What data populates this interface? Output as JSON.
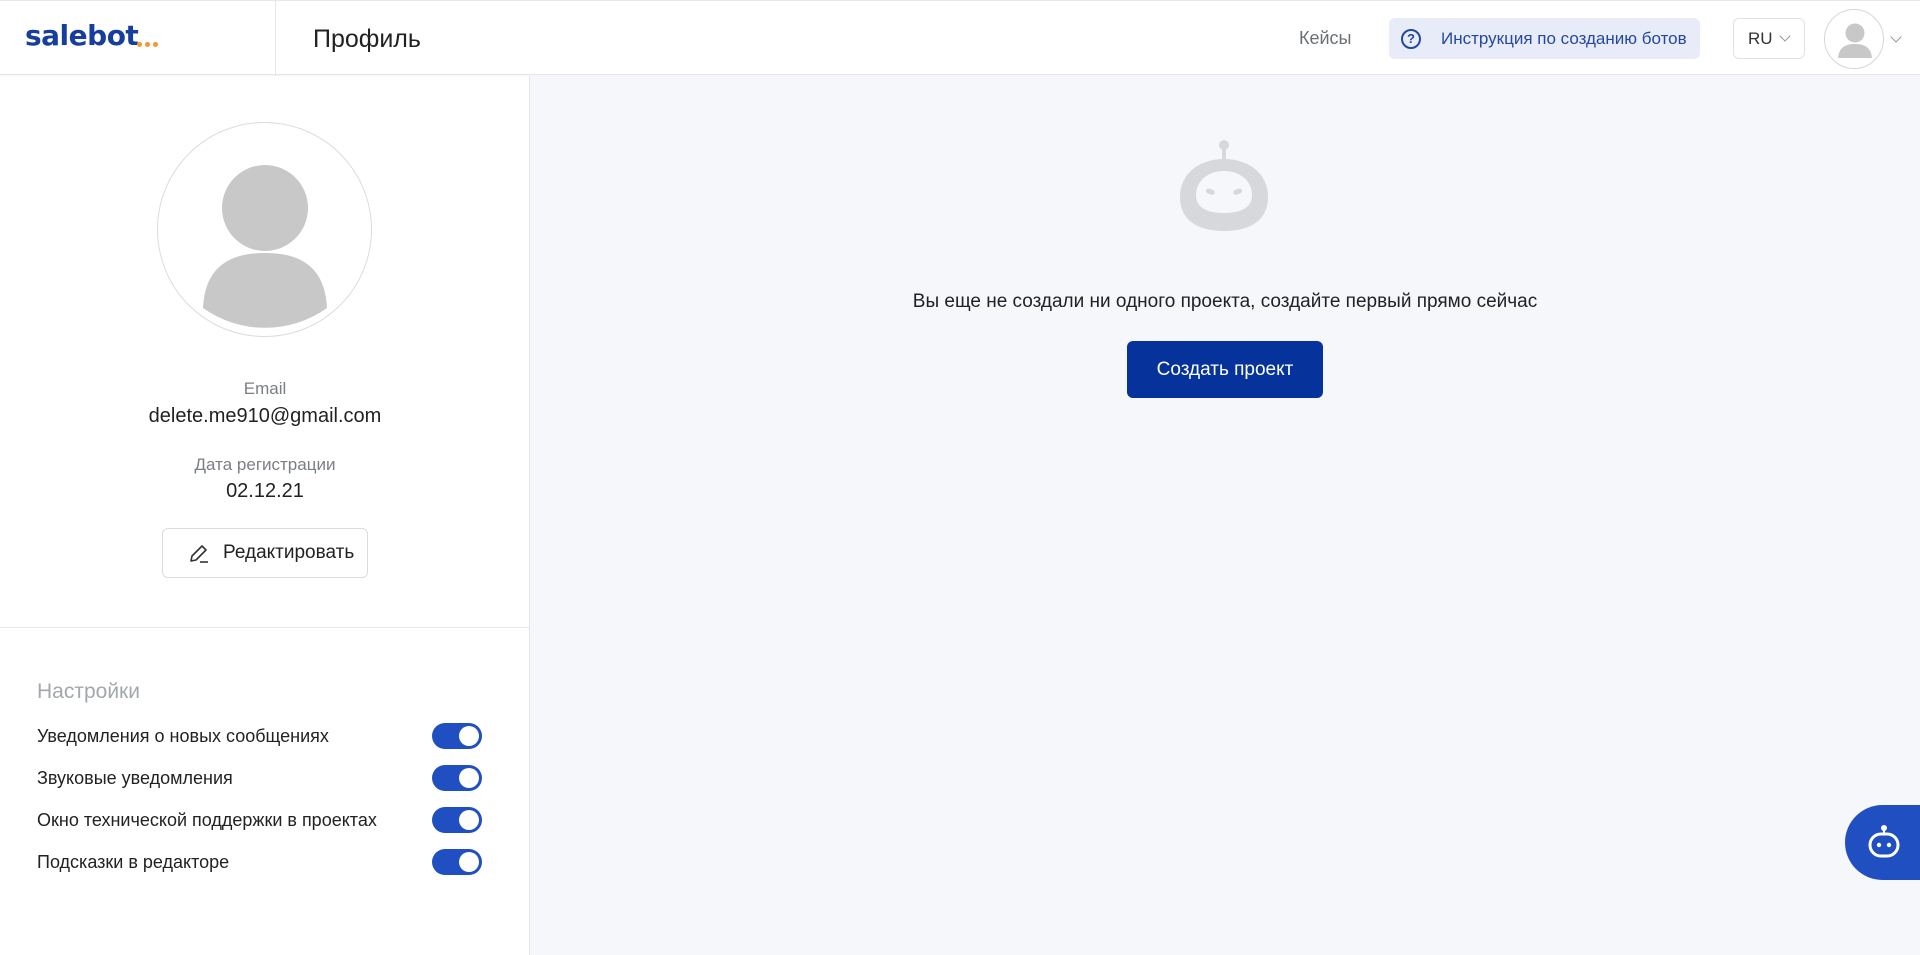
{
  "header": {
    "logo": "salebot",
    "page_title": "Профиль",
    "nav_cases": "Кейсы",
    "help_label": "Инструкция по созданию ботов",
    "language": "RU"
  },
  "profile": {
    "email_label": "Email",
    "email_value": "delete.me910@gmail.com",
    "reg_label": "Дата регистрации",
    "reg_value": "02.12.21",
    "edit_label": "Редактировать"
  },
  "settings": {
    "title": "Настройки",
    "items": [
      {
        "label": "Уведомления о новых сообщениях",
        "enabled": true
      },
      {
        "label": "Звуковые уведомления",
        "enabled": true
      },
      {
        "label": "Окно технической поддержки в проектах",
        "enabled": true
      },
      {
        "label": "Подсказки в редакторе",
        "enabled": true
      }
    ]
  },
  "main": {
    "empty_message": "Вы еще не создали ни одного проекта, создайте первый прямо сейчас",
    "create_label": "Создать проект"
  },
  "colors": {
    "brand": "#163e9d",
    "accent": "#f39a2b",
    "primary_button": "#06339b",
    "toggle_on": "#1f4fc1"
  },
  "icons": [
    "help-circle-icon",
    "chevron-down-icon",
    "user-avatar-icon",
    "pencil-icon",
    "robot-icon",
    "chat-bot-icon"
  ]
}
